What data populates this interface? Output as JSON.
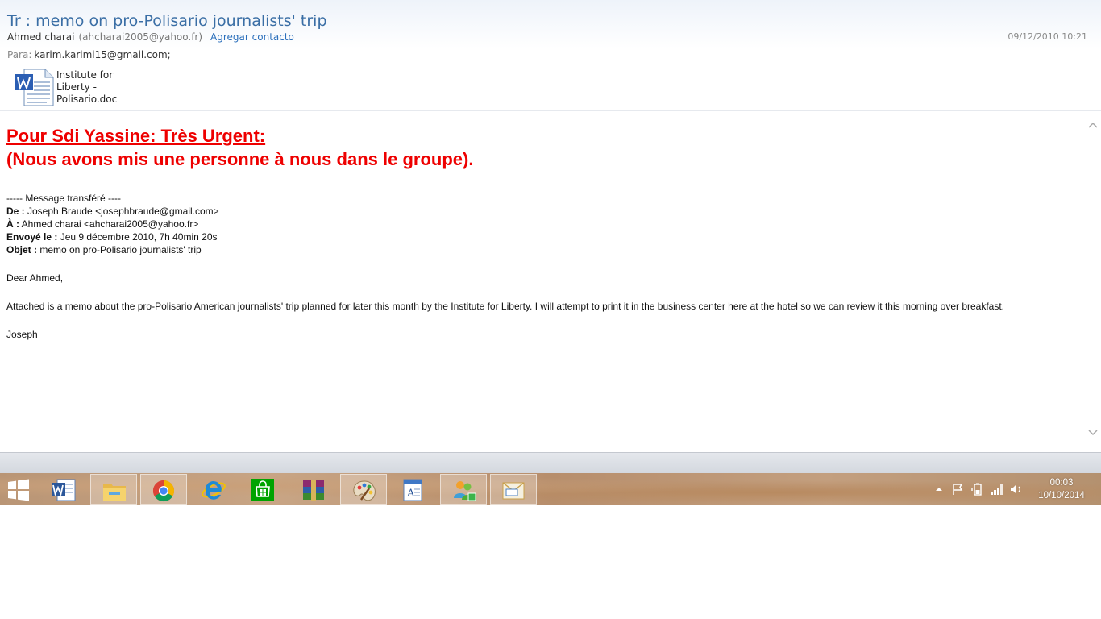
{
  "email": {
    "subject": "Tr : memo on pro-Polisario journalists' trip",
    "from_name": "Ahmed charai",
    "from_email": "(ahcharai2005@yahoo.fr)",
    "add_contact": "Agregar contacto",
    "date": "09/12/2010 10:21",
    "to_label": "Para:",
    "to_value": "karim.karimi15@gmail.com;",
    "attachment_name": "Institute for\nLiberty -\nPolisario.doc"
  },
  "body": {
    "urgent_line1": "Pour Sdi Yassine: Très Urgent:",
    "urgent_line2": "(Nous avons mis une personne à nous dans le groupe).",
    "forwarded_header": "----- Message transféré ----",
    "de_label": "De :",
    "de_value": " Joseph Braude <josephbraude@gmail.com>",
    "a_label": "À :",
    "a_value": " Ahmed charai <ahcharai2005@yahoo.fr>",
    "envoye_label": "Envoyé le :",
    "envoye_value": " Jeu 9 décembre 2010, 7h 40min 20s",
    "objet_label": "Objet :",
    "objet_value": " memo on pro-Polisario journalists' trip",
    "greeting": "Dear Ahmed,",
    "paragraph": "Attached is a memo about the pro-Polisario American journalists' trip planned for later this month by the Institute for Liberty.  I will attempt to print it in the business center here at the hotel so we can review it this morning over breakfast.",
    "signature": "Joseph"
  },
  "taskbar": {
    "apps": [
      {
        "name": "word-icon",
        "active": false
      },
      {
        "name": "file-explorer-icon",
        "active": true
      },
      {
        "name": "chrome-icon",
        "active": true
      },
      {
        "name": "internet-explorer-icon",
        "active": false
      },
      {
        "name": "store-icon",
        "active": false
      },
      {
        "name": "winrar-icon",
        "active": false
      },
      {
        "name": "paint-icon",
        "active": true
      },
      {
        "name": "wordpad-icon",
        "active": false
      },
      {
        "name": "messenger-icon",
        "active": true
      },
      {
        "name": "mail-window-icon",
        "active": true
      }
    ],
    "time": "00:03",
    "date": "10/10/2014"
  },
  "colors": {
    "subject": "#3a6ea5",
    "link": "#2a6ebb",
    "urgent": "#ee0000"
  }
}
